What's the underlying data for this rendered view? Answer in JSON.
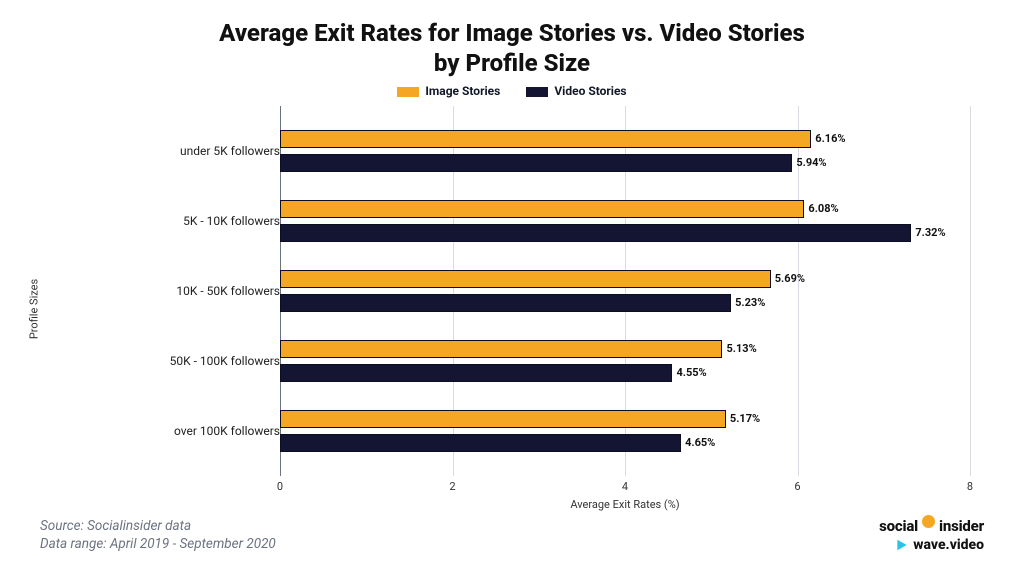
{
  "title_line1": "Average Exit Rates for Image Stories vs. Video Stories",
  "title_line2": "by Profile Size",
  "legend": {
    "image": "Image Stories",
    "video": "Video Stories"
  },
  "axis": {
    "ylabel": "Profile Sizes",
    "xlabel": "Average Exit Rates (%)"
  },
  "footer": {
    "source_line1": "Source: Socialinsider data",
    "source_line2": "Data range: April 2019 - September 2020",
    "logo1_a": "social",
    "logo1_b": "insider",
    "logo2": "wave.video"
  },
  "chart_data": {
    "type": "bar",
    "orientation": "horizontal",
    "categories": [
      "under 5K followers",
      "5K - 10K followers",
      "10K - 50K followers",
      "50K - 100K followers",
      "over 100K followers"
    ],
    "series": [
      {
        "name": "Image Stories",
        "color": "#F5A623",
        "values": [
          6.16,
          6.08,
          5.69,
          5.13,
          5.17
        ]
      },
      {
        "name": "Video Stories",
        "color": "#141433",
        "values": [
          5.94,
          7.32,
          5.23,
          4.55,
          4.65
        ]
      }
    ],
    "xlim": [
      0,
      8
    ],
    "xticks": [
      0,
      2,
      4,
      6,
      8
    ],
    "ylabel": "Profile Sizes",
    "xlabel": "Average Exit Rates (%)",
    "title": "Average Exit Rates for Image Stories vs. Video Stories by Profile Size",
    "value_suffix": "%"
  }
}
